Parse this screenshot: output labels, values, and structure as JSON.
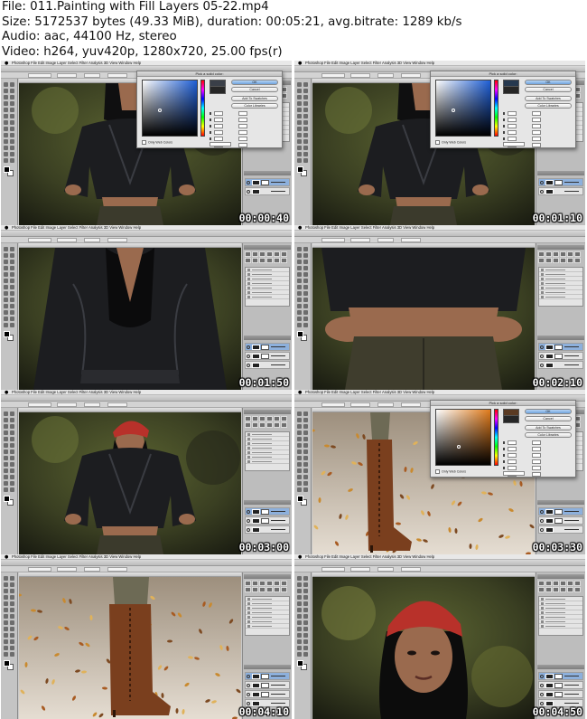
{
  "header": {
    "file": "File: 011.Painting with Fill Layers 05-22.mp4",
    "size": "Size: 5172537 bytes (49.33 MiB), duration: 00:05:21, avg.bitrate: 1289 kb/s",
    "audio": "Audio: aac, 44100 Hz, stereo",
    "video": "Video: h264, yuv420p, 1280x720, 25.00 fps(r)"
  },
  "app": {
    "name": "Photoshop",
    "menus": "Photoshop  File  Edit  Image  Layer  Select  Filter  Analysis  3D  View  Window  Help"
  },
  "picker": {
    "title": "Pick a solid color:",
    "ok": "OK",
    "cancel": "Cancel",
    "add_swatches": "Add To Swatches",
    "color_libraries": "Color Libraries",
    "web_only": "Only Web Colors"
  },
  "frames": [
    {
      "timestamp": "00:00:40",
      "scene": "torso",
      "picker": true,
      "picker_field": "#1f5fd6",
      "picker_new": "#3a3f48",
      "picker_old": "#262626"
    },
    {
      "timestamp": "00:01:10",
      "scene": "torso",
      "picker": true,
      "picker_field": "#1f5fd6",
      "picker_new": "#25384f",
      "picker_old": "#262626"
    },
    {
      "timestamp": "00:01:50",
      "scene": "jacket",
      "picker": false
    },
    {
      "timestamp": "00:02:10",
      "scene": "hands",
      "picker": false
    },
    {
      "timestamp": "00:03:00",
      "scene": "torso-hat",
      "picker": false
    },
    {
      "timestamp": "00:03:30",
      "scene": "boot-wide",
      "picker": true,
      "picker_field": "#e07b1c",
      "picker_new": "#5a3a22",
      "picker_old": "#262626"
    },
    {
      "timestamp": "00:04:10",
      "scene": "boot-close",
      "picker": false
    },
    {
      "timestamp": "00:04:50",
      "scene": "face",
      "picker": false
    }
  ],
  "colors": {
    "leather": "#1c1d20",
    "foliage": "#4f5a2c",
    "skin": "#9a6a4e",
    "hat": "#b8312a",
    "boot": "#7a3f1e",
    "ground": "#cdbfad"
  }
}
